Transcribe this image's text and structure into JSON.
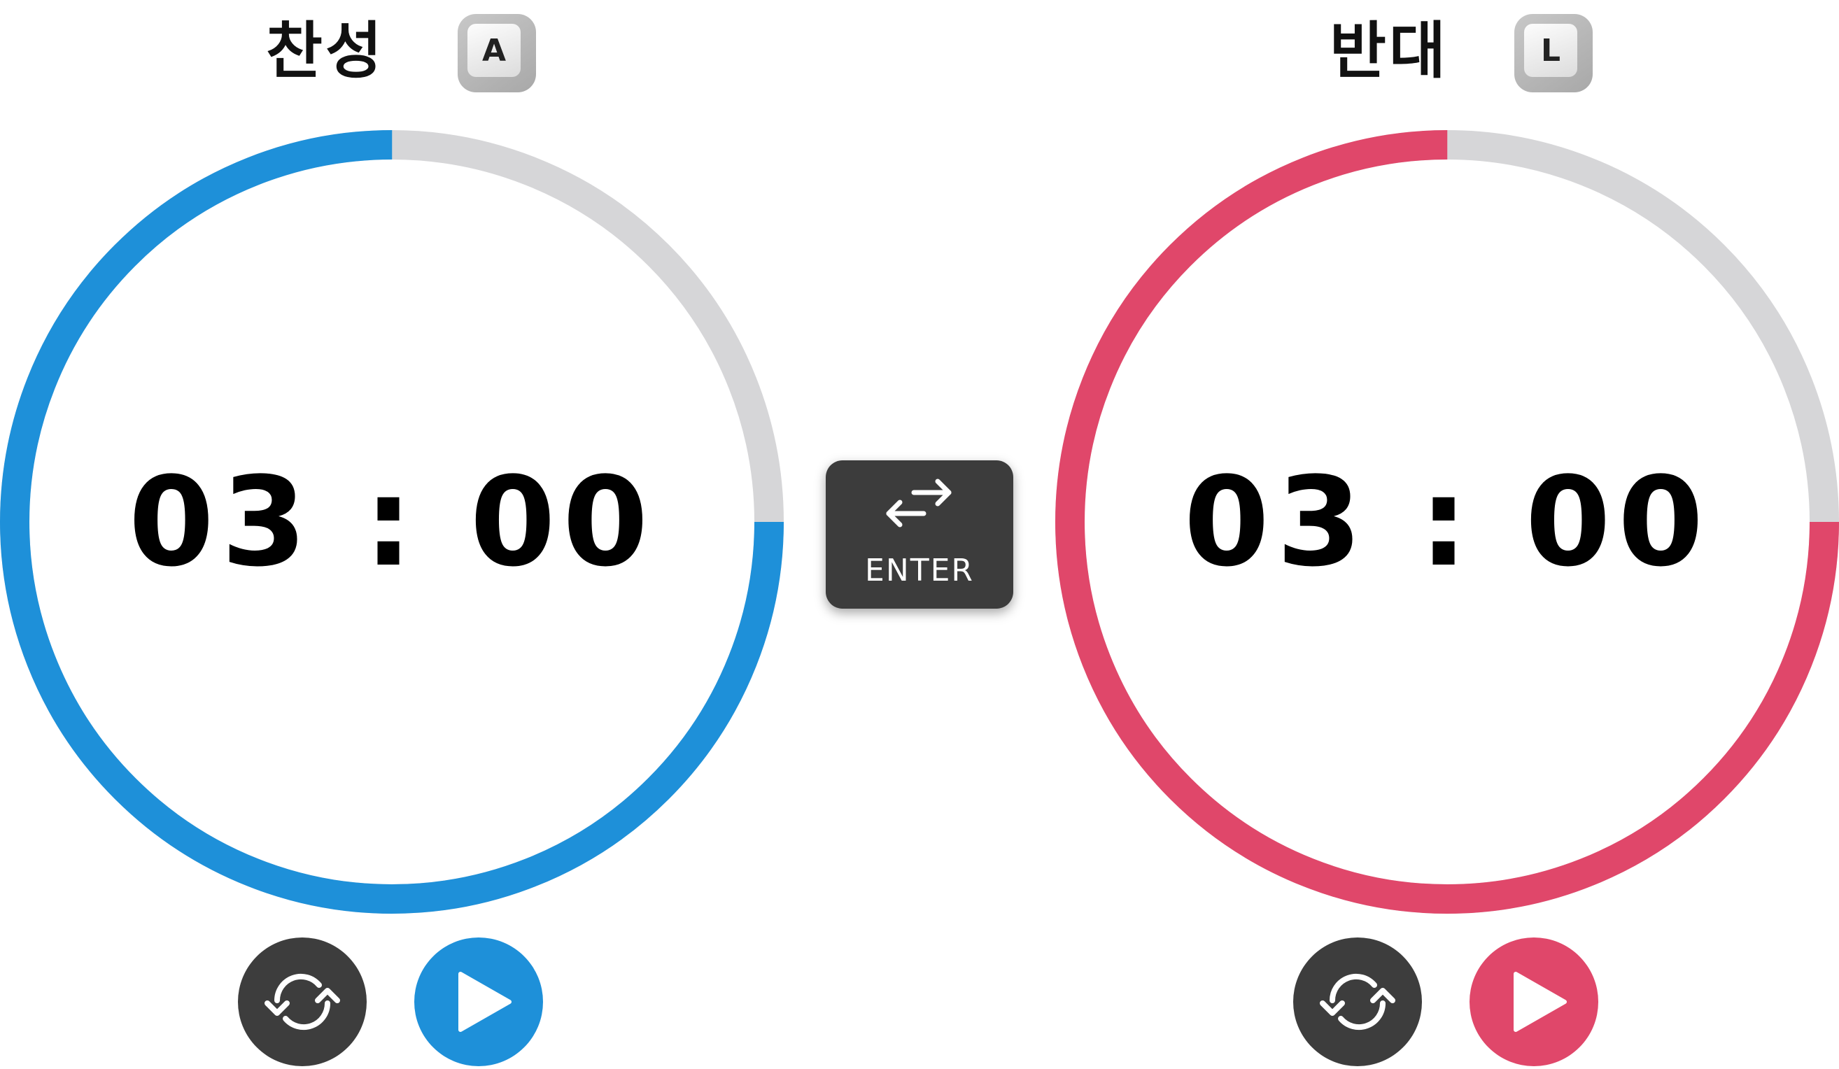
{
  "left": {
    "title": "찬성",
    "key": "A",
    "time": "03 : 00",
    "color": "#1e90d9",
    "progress": 0.75
  },
  "right": {
    "title": "반대",
    "key": "L",
    "time": "03 : 00",
    "color": "#e0476a",
    "progress": 0.75
  },
  "swap": {
    "label": "ENTER"
  },
  "track_color": "#d6d6d8",
  "icons": [
    "swap-arrows-icon",
    "reset-arrows-icon",
    "play-icon"
  ]
}
